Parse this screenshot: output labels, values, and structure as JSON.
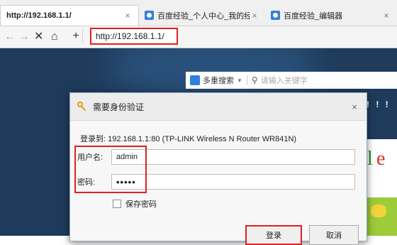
{
  "tabs": [
    {
      "title": "http://192.168.1.1/",
      "close": "×"
    },
    {
      "title": "百度经验_个人中心_我的经验",
      "close": "×"
    },
    {
      "title": "百度经验_编辑器",
      "close": "×"
    }
  ],
  "nav": {
    "back_icon": "←",
    "forward_icon": "→",
    "stop_icon": "✕",
    "home_icon": "⌂",
    "new_tab_icon": "+",
    "url": "http://192.168.1.1/"
  },
  "page": {
    "search": {
      "engine": "多重搜索",
      "placeholder": "请输入关键字"
    },
    "logo_letters": [
      "l",
      "e"
    ],
    "dots": "! ! !"
  },
  "dialog": {
    "title": "需要身份验证",
    "close": "×",
    "message": "登录到: 192.168.1.1:80 (TP-LINK Wireless N Router WR841N)",
    "username_label": "用户名:",
    "username_value": "admin",
    "password_label": "密码:",
    "password_value": "•••••",
    "remember_label": "保存密码",
    "login_label": "登录",
    "cancel_label": "取消"
  },
  "colors": {
    "highlight": "#e02020",
    "key_icon": "#e49a12",
    "favicon": "#2f7fe0"
  }
}
